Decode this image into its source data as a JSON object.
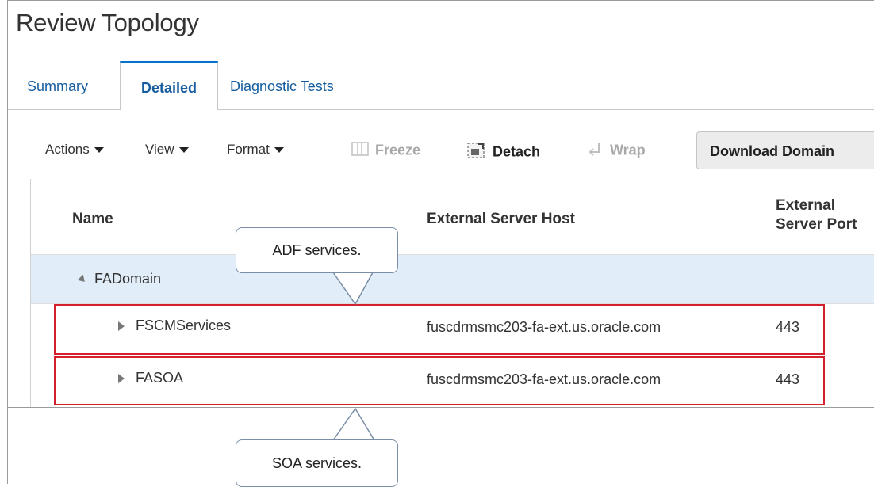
{
  "page": {
    "title": "Review Topology"
  },
  "tabs": [
    {
      "label": "Summary"
    },
    {
      "label": "Detailed"
    },
    {
      "label": "Diagnostic Tests"
    }
  ],
  "toolbar": {
    "actions_label": "Actions",
    "view_label": "View",
    "format_label": "Format",
    "freeze_label": "Freeze",
    "detach_label": "Detach",
    "wrap_label": "Wrap",
    "download_label": "Download Domain"
  },
  "table": {
    "columns": [
      "Name",
      "External Server Host",
      "External Server Port"
    ],
    "domain_row": {
      "name": "FADomain"
    },
    "rows": [
      {
        "name": "FSCMServices",
        "host": "fuscdrmsmc203-fa-ext.us.oracle.com",
        "port": "443"
      },
      {
        "name": "FASOA",
        "host": "fuscdrmsmc203-fa-ext.us.oracle.com",
        "port": "443"
      }
    ]
  },
  "callouts": {
    "adf": "ADF services.",
    "soa": "SOA services."
  },
  "colors": {
    "accent": "#0572ce",
    "link": "#145c9e",
    "highlight": "#d4202c",
    "selected_row": "#e1edf9"
  }
}
